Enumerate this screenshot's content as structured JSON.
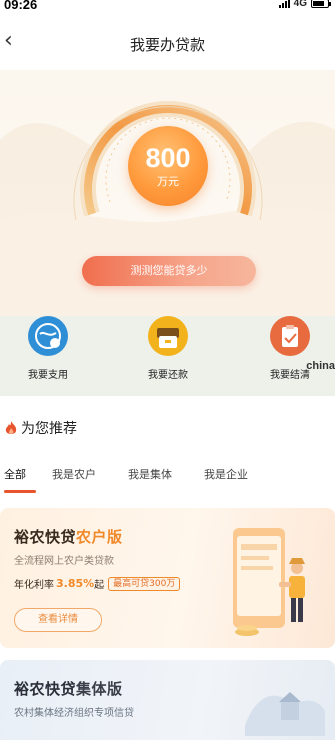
{
  "status_bar": {
    "time": "09:26",
    "network": "4G"
  },
  "nav": {
    "title": "我要办贷款"
  },
  "hero": {
    "amount": "800",
    "unit": "万元",
    "calc_button": "测测您能贷多少"
  },
  "quick_actions": [
    {
      "label": "我要支用",
      "icon": "globe-icon",
      "color": "#2f8fd6"
    },
    {
      "label": "我要还款",
      "icon": "wallet-icon",
      "color": "#f2b21c"
    },
    {
      "label": "我要结清",
      "icon": "clipboard-check-icon",
      "color": "#e76b3e"
    }
  ],
  "watermark": "china",
  "recommend": {
    "title": "为您推荐",
    "tabs": [
      "全部",
      "我是农户",
      "我是集体",
      "我是企业"
    ],
    "active_tab": 0,
    "cards": [
      {
        "title_main": "裕农快贷",
        "title_accent": "农户版",
        "desc": "全流程网上农户类贷款",
        "rate_label": "年化利率",
        "rate_value": "3.85%",
        "rate_suffix": "起",
        "limit_badge": "最高可贷300万",
        "detail_button": "查看详情"
      },
      {
        "title_main": "裕农快贷",
        "title_accent": "集体版",
        "desc": "农村集体经济组织专项信贷"
      }
    ]
  }
}
